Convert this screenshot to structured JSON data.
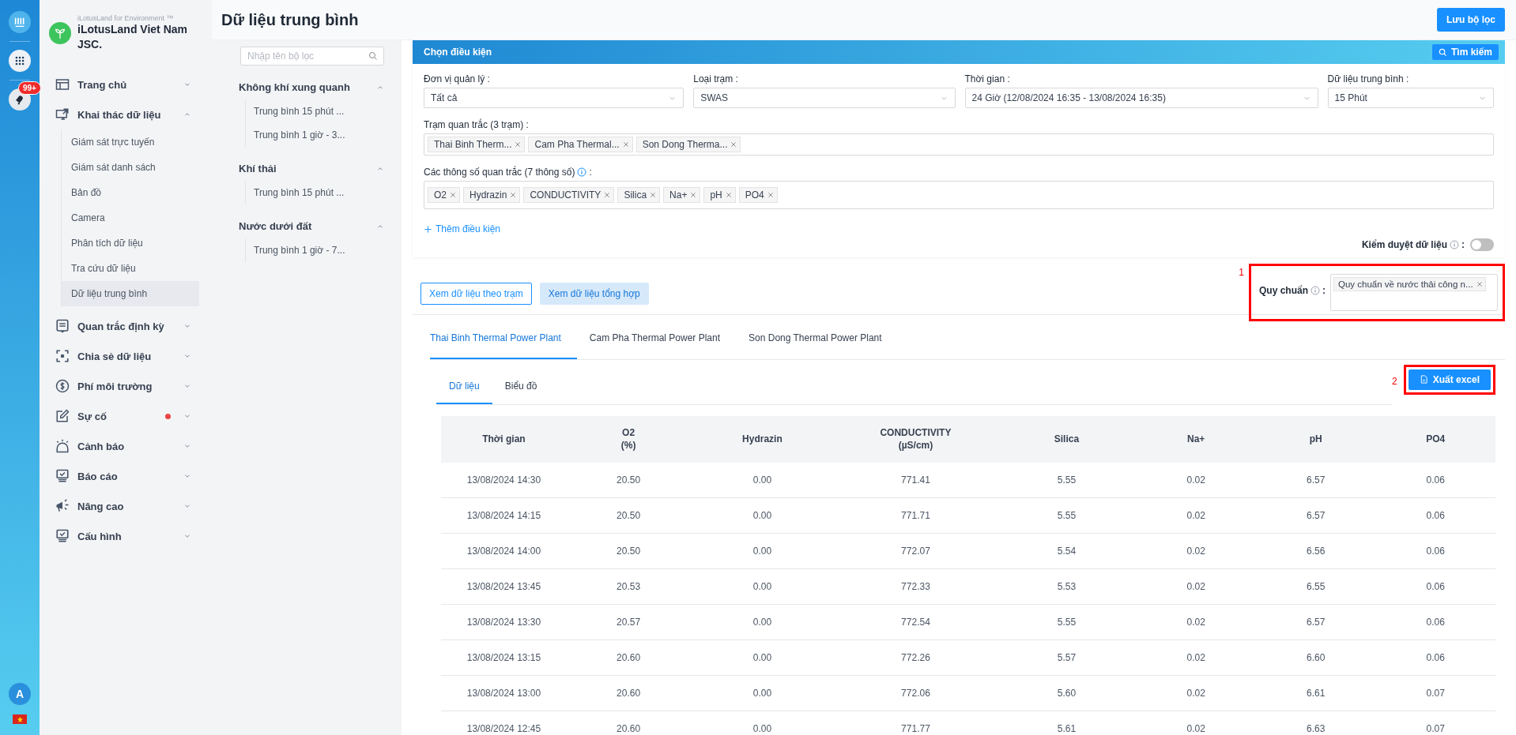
{
  "rail": {
    "badge": "99+",
    "avatar": "A"
  },
  "brand": {
    "tagline": "iLotusLand for Environment ™",
    "name": "iLotusLand Viet Nam JSC."
  },
  "menu": [
    {
      "label": "Trang chủ",
      "expanded": false,
      "alert": false
    },
    {
      "label": "Khai thác dữ liệu",
      "expanded": true,
      "alert": false,
      "children": [
        {
          "label": "Giám sát trực tuyến",
          "selected": false
        },
        {
          "label": "Giám sát danh sách",
          "selected": false
        },
        {
          "label": "Bản đồ",
          "selected": false
        },
        {
          "label": "Camera",
          "selected": false
        },
        {
          "label": "Phân tích dữ liệu",
          "selected": false
        },
        {
          "label": "Tra cứu dữ liệu",
          "selected": false
        },
        {
          "label": "Dữ liệu trung bình",
          "selected": true
        }
      ]
    },
    {
      "label": "Quan trắc định kỳ",
      "expanded": false,
      "alert": false
    },
    {
      "label": "Chia sẻ dữ liệu",
      "expanded": false,
      "alert": false
    },
    {
      "label": "Phí môi trường",
      "expanded": false,
      "alert": false
    },
    {
      "label": "Sự cố",
      "expanded": false,
      "alert": true
    },
    {
      "label": "Cảnh báo",
      "expanded": false,
      "alert": false
    },
    {
      "label": "Báo cáo",
      "expanded": false,
      "alert": false
    },
    {
      "label": "Nâng cao",
      "expanded": false,
      "alert": false
    },
    {
      "label": "Cấu hình",
      "expanded": false,
      "alert": false
    }
  ],
  "page_title": "Dữ liệu trung bình",
  "save_button": "Lưu bộ lọc",
  "filters": {
    "search_placeholder": "Nhập tên bộ lọc",
    "groups": [
      {
        "title": "Không khí xung quanh",
        "expanded": true,
        "items": [
          "Trung bình 15 phút ...",
          "Trung bình 1 giờ - 3..."
        ]
      },
      {
        "title": "Khí thải",
        "expanded": true,
        "items": [
          "Trung bình 15 phút ..."
        ]
      },
      {
        "title": "Nước dưới đất",
        "expanded": true,
        "items": [
          "Trung bình 1 giờ - 7..."
        ]
      }
    ]
  },
  "conditions": {
    "title": "Chọn điều kiện",
    "search_button": "Tìm kiếm",
    "fields": [
      {
        "label": "Đơn vị quản lý :",
        "value": "Tất cả"
      },
      {
        "label": "Loại trạm :",
        "value": "SWAS"
      },
      {
        "label": "Thời gian :",
        "value": "24 Giờ (12/08/2024 16:35 - 13/08/2024 16:35)"
      },
      {
        "label": "Dữ liệu trung bình :",
        "value": "15 Phút"
      }
    ],
    "stations": {
      "label": "Trạm quan trắc (3 trạm) :",
      "tags": [
        "Thai Binh Therm...",
        "Cam Pha Thermal...",
        "Son Dong Therma..."
      ]
    },
    "params": {
      "label": "Các thông số quan trắc (7 thông số)",
      "suffix": ":",
      "tags": [
        "O2",
        "Hydrazin",
        "CONDUCTIVITY",
        "Silica",
        "Na+",
        "pH",
        "PO4"
      ]
    },
    "add_condition": "Thêm điều kiện",
    "moderation": {
      "label": "Kiểm duyệt dữ liệu",
      "suffix": ":",
      "on": false
    }
  },
  "view_buttons": [
    {
      "label": "Xem dữ liệu theo trạm",
      "selected": true
    },
    {
      "label": "Xem dữ liệu tổng hợp",
      "selected": false
    }
  ],
  "standard": {
    "marker": "1",
    "label": "Quy chuẩn",
    "suffix": ":",
    "tags": [
      "Quy chuẩn về nước thải công n..."
    ]
  },
  "station_tabs": [
    {
      "label": "Thai Binh Thermal Power Plant",
      "selected": true
    },
    {
      "label": "Cam Pha Thermal Power Plant",
      "selected": false
    },
    {
      "label": "Son Dong Thermal Power Plant",
      "selected": false
    }
  ],
  "sub_tabs": [
    {
      "label": "Dữ liệu",
      "selected": true
    },
    {
      "label": "Biểu đồ",
      "selected": false
    }
  ],
  "export": {
    "marker": "2",
    "label": "Xuất excel"
  },
  "table": {
    "columns": [
      {
        "name": "Thời gian"
      },
      {
        "name": "O2",
        "unit": "(%)"
      },
      {
        "name": "Hydrazin"
      },
      {
        "name": "CONDUCTIVITY",
        "unit": "(µS/cm)"
      },
      {
        "name": "Silica"
      },
      {
        "name": "Na+"
      },
      {
        "name": "pH"
      },
      {
        "name": "PO4"
      }
    ],
    "rows": [
      [
        "13/08/2024 14:30",
        "20.50",
        "0.00",
        "771.41",
        "5.55",
        "0.02",
        "6.57",
        "0.06"
      ],
      [
        "13/08/2024 14:15",
        "20.50",
        "0.00",
        "771.71",
        "5.55",
        "0.02",
        "6.57",
        "0.06"
      ],
      [
        "13/08/2024 14:00",
        "20.50",
        "0.00",
        "772.07",
        "5.54",
        "0.02",
        "6.56",
        "0.06"
      ],
      [
        "13/08/2024 13:45",
        "20.53",
        "0.00",
        "772.33",
        "5.53",
        "0.02",
        "6.55",
        "0.06"
      ],
      [
        "13/08/2024 13:30",
        "20.57",
        "0.00",
        "772.54",
        "5.55",
        "0.02",
        "6.57",
        "0.06"
      ],
      [
        "13/08/2024 13:15",
        "20.60",
        "0.00",
        "772.26",
        "5.57",
        "0.02",
        "6.60",
        "0.06"
      ],
      [
        "13/08/2024 13:00",
        "20.60",
        "0.00",
        "772.06",
        "5.60",
        "0.02",
        "6.61",
        "0.07"
      ],
      [
        "13/08/2024 12:45",
        "20.60",
        "0.00",
        "771.77",
        "5.61",
        "0.02",
        "6.63",
        "0.07"
      ]
    ]
  }
}
